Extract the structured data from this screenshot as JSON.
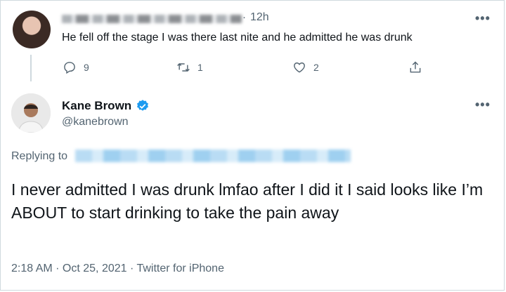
{
  "tweet1": {
    "time": "12h",
    "text": "He fell off the stage I was there last nite and he admitted he was drunk",
    "replies": "9",
    "retweets": "1",
    "likes": "2",
    "more": "•••"
  },
  "tweet2": {
    "name": "Kane Brown",
    "handle": "@kanebrown",
    "more": "•••",
    "replying_to": "Replying to",
    "text": "I never admitted I was drunk lmfao after I did it I said looks like I’m ABOUT to start drinking to take the pain away",
    "meta": "2:18 AM · Oct 25, 2021 · Twitter for iPhone"
  },
  "colors": {
    "accent": "#1d9bf0",
    "muted": "#536471",
    "text": "#0f1419"
  }
}
